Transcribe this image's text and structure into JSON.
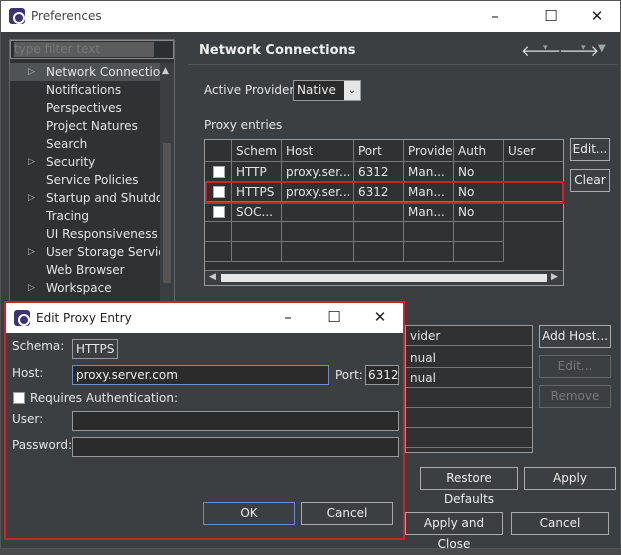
{
  "window": {
    "title": "Preferences"
  },
  "sidebar": {
    "filter_placeholder": "type filter text",
    "items": [
      {
        "label": "Network Connection",
        "arrow": true,
        "selected": true
      },
      {
        "label": "Notifications",
        "arrow": false
      },
      {
        "label": "Perspectives",
        "arrow": false
      },
      {
        "label": "Project Natures",
        "arrow": false
      },
      {
        "label": "Search",
        "arrow": false
      },
      {
        "label": "Security",
        "arrow": true
      },
      {
        "label": "Service Policies",
        "arrow": false
      },
      {
        "label": "Startup and Shutdow",
        "arrow": true
      },
      {
        "label": "Tracing",
        "arrow": false
      },
      {
        "label": "UI Responsiveness M",
        "arrow": false
      },
      {
        "label": "User Storage Service",
        "arrow": true
      },
      {
        "label": "Web Browser",
        "arrow": false
      },
      {
        "label": "Workspace",
        "arrow": true
      }
    ]
  },
  "main": {
    "title": "Network Connections",
    "active_provider_label": "Active Provider:",
    "active_provider_value": "Native",
    "proxy_entries_label": "Proxy entries",
    "columns": [
      "Schem",
      "Host",
      "Port",
      "Provide",
      "Auth",
      "User"
    ],
    "rows": [
      {
        "schema": "HTTP",
        "host": "proxy.ser...",
        "port": "6312",
        "provider": "Man...",
        "auth": "No",
        "user": ""
      },
      {
        "schema": "HTTPS",
        "host": "proxy.ser...",
        "port": "6312",
        "provider": "Man...",
        "auth": "No",
        "user": ""
      },
      {
        "schema": "SOC...",
        "host": "",
        "port": "",
        "provider": "Man...",
        "auth": "No",
        "user": ""
      }
    ],
    "edit_button": "Edit...",
    "clear_button": "Clear",
    "bypass_rows": [
      "vider",
      "nual",
      "nual"
    ],
    "add_host_button": "Add Host...",
    "edit2_button": "Edit...",
    "remove_button": "Remove",
    "restore_defaults_button": "Restore Defaults",
    "apply_button": "Apply",
    "apply_close_button": "Apply and Close",
    "cancel_button": "Cancel"
  },
  "dialog": {
    "title": "Edit Proxy Entry",
    "schema_label": "Schema:",
    "schema_value": "HTTPS",
    "host_label": "Host:",
    "host_value": "proxy.server.com",
    "port_label": "Port:",
    "port_value": "6312",
    "requires_auth_label": "Requires Authentication:",
    "user_label": "User:",
    "password_label": "Password:",
    "ok_button": "OK",
    "cancel_button": "Cancel"
  }
}
